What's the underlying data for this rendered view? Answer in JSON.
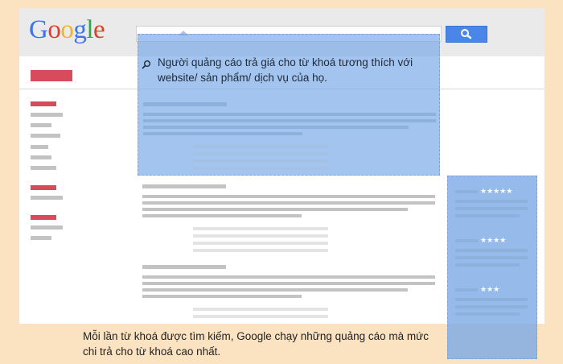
{
  "logo": {
    "letters": [
      "G",
      "o",
      "o",
      "g",
      "l",
      "e"
    ],
    "colors": [
      "#3c75e6",
      "#d8402f",
      "#f3b324",
      "#3c75e6",
      "#2fa54c",
      "#d8402f"
    ]
  },
  "search": {
    "button_icon": "search-icon"
  },
  "overlay_top_text": "Người quảng cáo trả giá cho từ khoá tương thích với website/ sản phẩm/ dịch vụ của họ.",
  "ads_sidebar": {
    "ratings": [
      "★★★★★",
      "★★★★",
      "★★★"
    ]
  },
  "caption": "Mỗi lần từ khoá được tìm kiếm, Google chạy những quảng cáo mà mức chi trả cho từ khoá cao nhất.",
  "colors": {
    "background": "#fbe3c2",
    "accent_blue": "#4a86e8",
    "ad_red": "#d64c5c",
    "overlay_blue": "#78a8e6"
  }
}
